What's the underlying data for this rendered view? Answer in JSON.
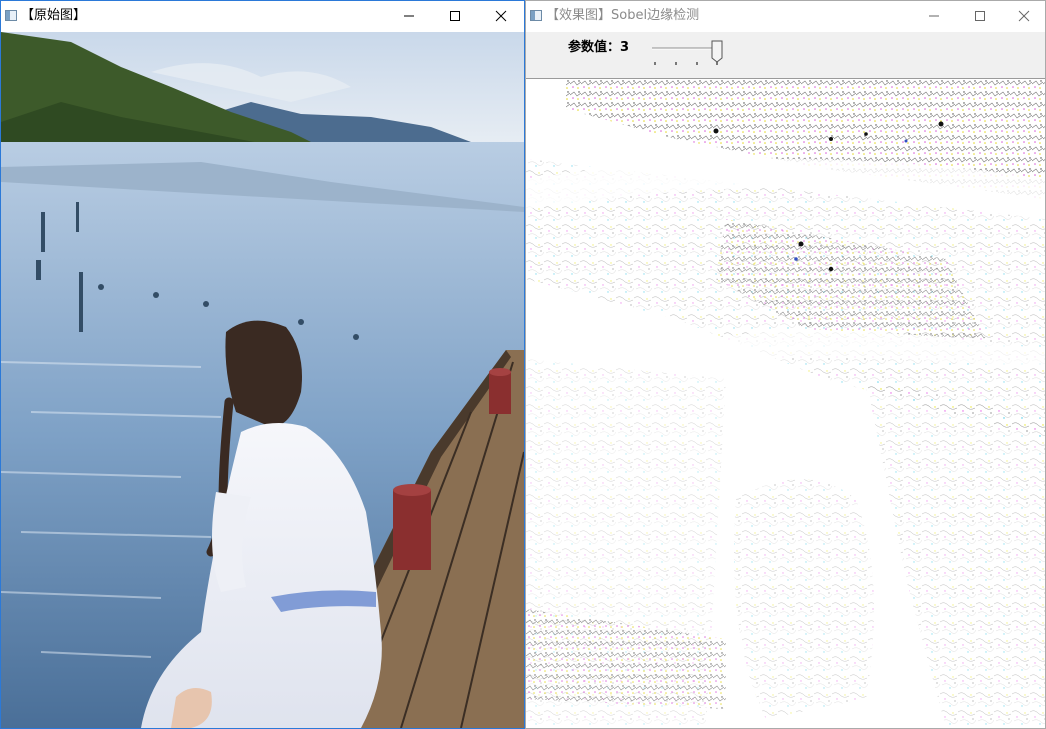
{
  "left_window": {
    "title": "【原始图】",
    "image_icon": "photo-girl-on-pier",
    "controls": [
      "minimize-icon",
      "maximize-icon",
      "close-icon"
    ]
  },
  "right_window": {
    "title": "【效果图】Sobel边缘检测",
    "image_icon": "sobel-edge-image",
    "param": {
      "label": "参数值：",
      "value": "3",
      "level": 1.0
    },
    "controls": [
      "minimize-icon",
      "maximize-icon",
      "close-icon"
    ]
  },
  "colors": {
    "active_border": "#2b79d8",
    "inactive_title": "#8a8a8a"
  }
}
